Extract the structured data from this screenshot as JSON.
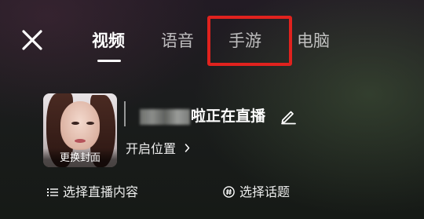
{
  "header": {
    "tabs": [
      {
        "label": "视频",
        "active": true
      },
      {
        "label": "语音",
        "active": false
      },
      {
        "label": "手游",
        "active": false
      },
      {
        "label": "电脑",
        "active": false
      }
    ],
    "close_icon": "close-icon",
    "highlight_color": "#e0221e"
  },
  "stream_setup": {
    "cover_label": "更换封面",
    "title_suffix": "啦正在直播",
    "location_label": "开启位置",
    "edit_icon": "pencil-icon",
    "chevron_icon": "chevron-right-icon"
  },
  "options": {
    "content_label": "选择直播内容",
    "content_icon": "list-icon",
    "topic_label": "选择话题",
    "topic_icon": "hashtag-icon"
  }
}
